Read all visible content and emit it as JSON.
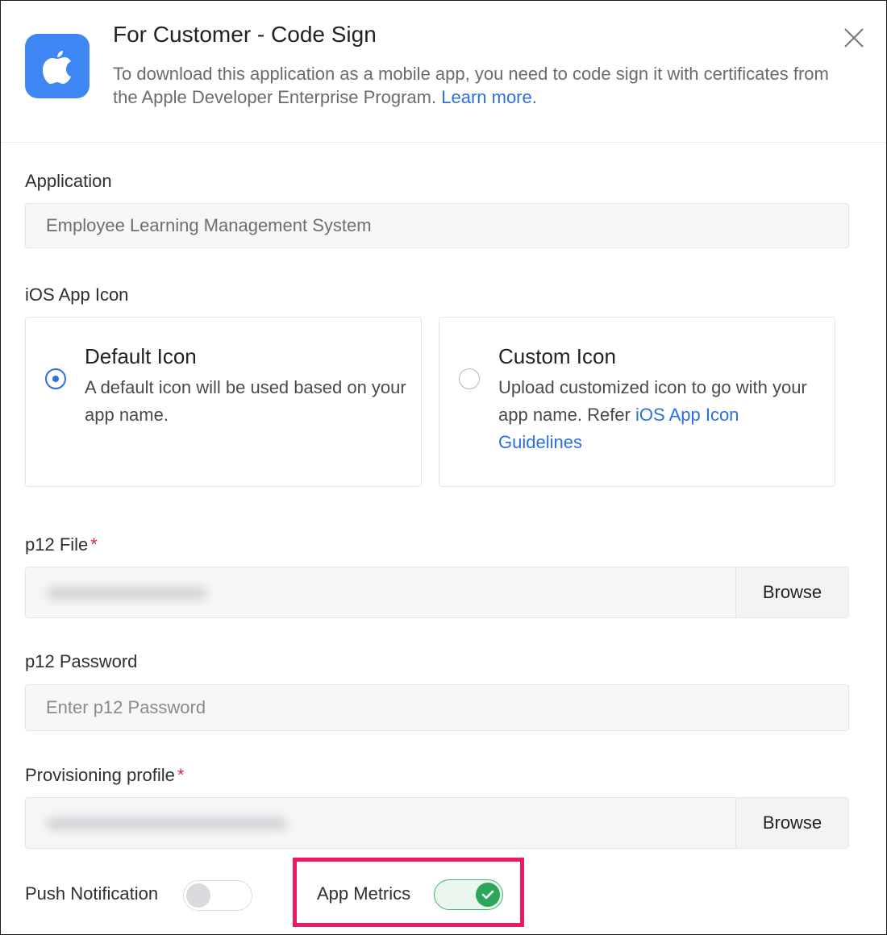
{
  "header": {
    "title": "For Customer - Code Sign",
    "description": "To download this application as a mobile app, you need to code sign it with certificates from the Apple Developer Enterprise Program.",
    "learn_more": "Learn more.",
    "logo_icon": "apple-logo-icon",
    "close_icon": "close-icon"
  },
  "application": {
    "label": "Application",
    "value": "Employee Learning Management System"
  },
  "ios_icon": {
    "label": "iOS App Icon",
    "default": {
      "title": "Default Icon",
      "text": "A default icon will be used based on your app name.",
      "selected": true
    },
    "custom": {
      "title": "Custom Icon",
      "text": "Upload customized icon to go with your app name. Refer",
      "link": "iOS App Icon Guidelines",
      "selected": false
    }
  },
  "p12_file": {
    "label": "p12 File",
    "required_mark": "*",
    "browse": "Browse"
  },
  "p12_password": {
    "label": "p12 Password",
    "placeholder": "Enter p12 Password"
  },
  "provisioning": {
    "label": "Provisioning profile",
    "required_mark": "*",
    "browse": "Browse"
  },
  "toggles": {
    "push_label": "Push Notification",
    "push_on": false,
    "metrics_label": "App Metrics",
    "metrics_on": true
  },
  "colors": {
    "accent": "#2c6fe0",
    "logo_bg": "#3f86f5",
    "required": "#e0263a",
    "toggle_on": "#2da55c",
    "highlight": "#f0195d"
  }
}
